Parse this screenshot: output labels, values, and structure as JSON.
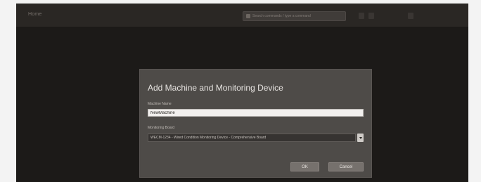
{
  "topbar": {
    "title": "Home",
    "command_text": "Search commands / type a command"
  },
  "dialog": {
    "title": "Add Machine and Monitoring Device",
    "machine_name_label": "Machine Name",
    "machine_name_value": "NewMachine",
    "monitoring_board_label": "Monitoring Board",
    "monitoring_board_value": "WECM-1234 - Wired Condition Monitoring Device - Comprehensive Board",
    "ok_label": "OK",
    "cancel_label": "Cancel"
  }
}
